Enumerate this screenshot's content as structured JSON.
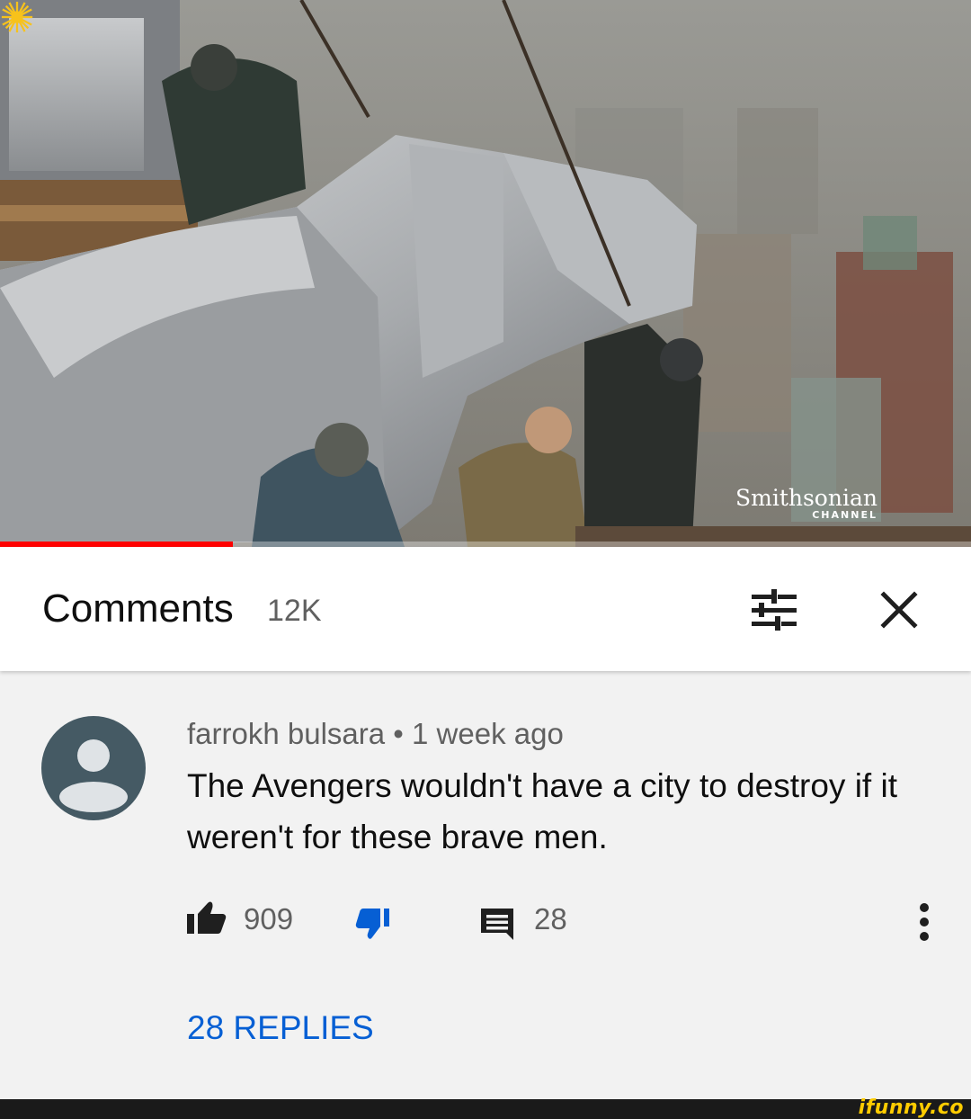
{
  "video": {
    "watermark_name": "Smithsonian",
    "watermark_sub": "CHANNEL",
    "progress_fraction": 0.24
  },
  "header": {
    "title": "Comments",
    "count": "12K"
  },
  "comment": {
    "author": "farrokh bulsara",
    "separator": "•",
    "time": "1 week ago",
    "text": "The Avengers wouldn't have a city to destroy if it weren't for these brave men.",
    "likes": "909",
    "replies_count": "28",
    "replies_link": "28 REPLIES"
  },
  "footer": {
    "brand": "ifunny.co"
  },
  "colors": {
    "accent_red": "#ff0000",
    "link_blue": "#065fd4",
    "avatar": "#455a64",
    "brand_yellow": "#ffcc00"
  },
  "icons": [
    "sort-icon",
    "close-icon",
    "like-icon",
    "dislike-icon",
    "reply-icon",
    "more-icon",
    "avatar-icon",
    "sun-logo-icon"
  ]
}
